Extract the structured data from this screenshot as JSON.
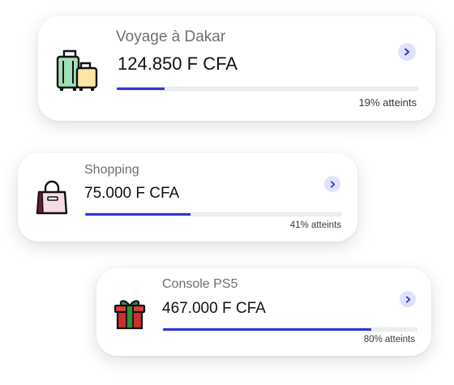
{
  "goals": [
    {
      "title": "Voyage à Dakar",
      "amount": "124.850 F CFA",
      "progress_label": "19% atteints",
      "progress": 0.16,
      "icon": "luggage-icon"
    },
    {
      "title": "Shopping",
      "amount": "75.000 F CFA",
      "progress_label": "41% atteints",
      "progress": 0.41,
      "icon": "shopping-bag-icon"
    },
    {
      "title": "Console PS5",
      "amount": "467.000 F CFA",
      "progress_label": "80% atteints",
      "progress": 0.82,
      "icon": "gift-icon"
    }
  ],
  "colors": {
    "progress_fill": "#2e38d8",
    "progress_track": "#eceef2",
    "chevron_bg": "#dfe2fb",
    "chevron_fg": "#2e38d8"
  }
}
